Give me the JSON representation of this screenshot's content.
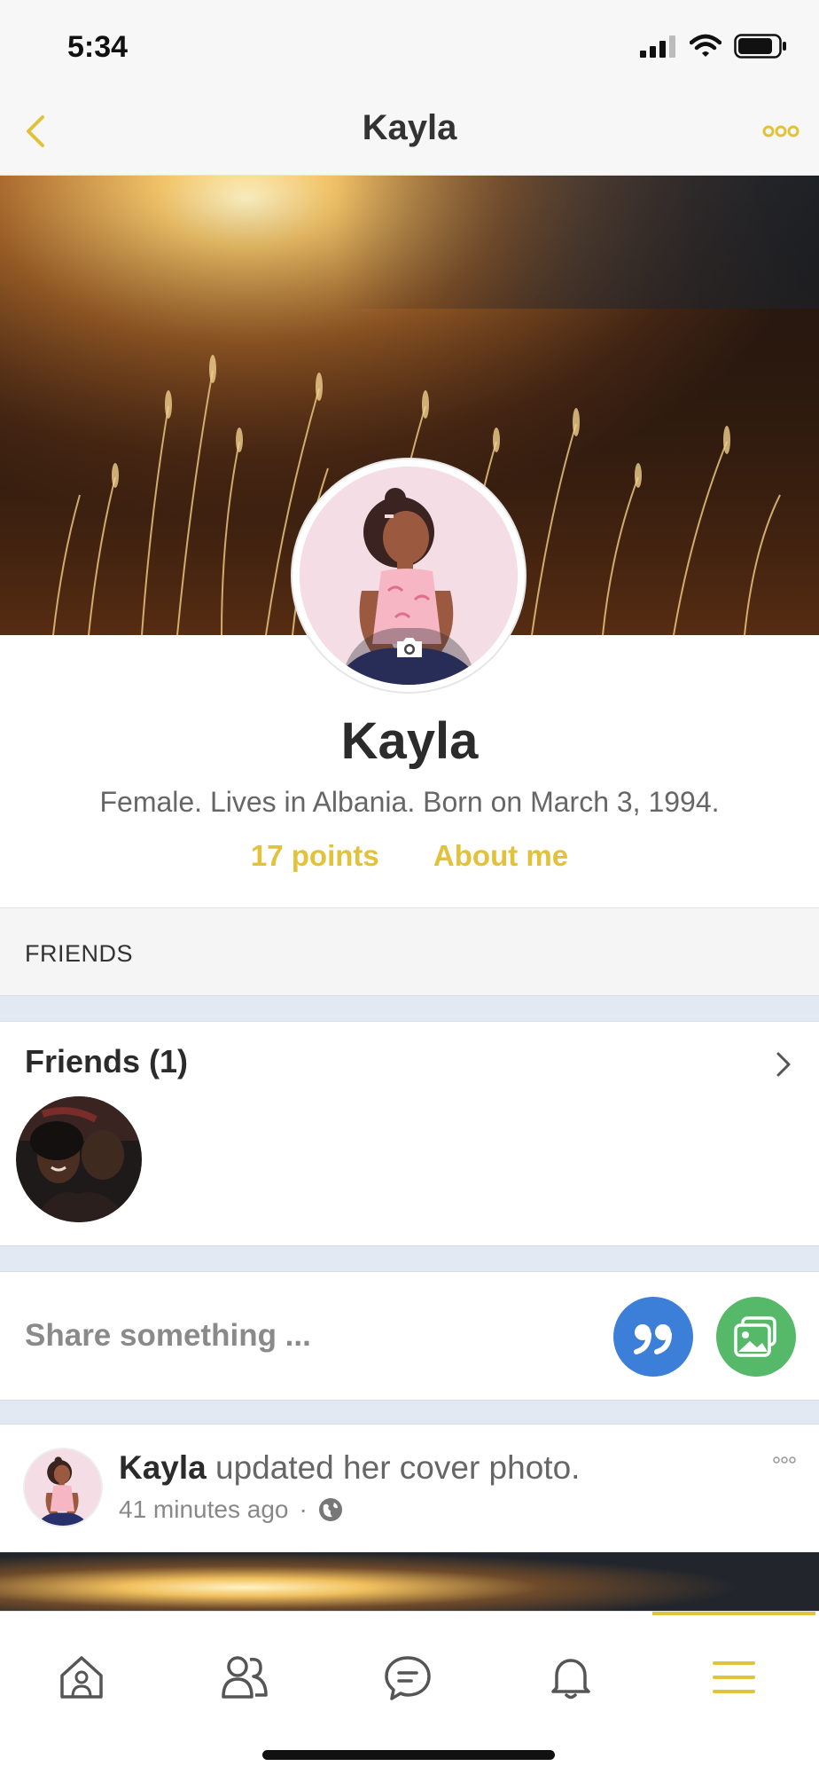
{
  "status_bar": {
    "time": "5:34"
  },
  "nav": {
    "title": "Kayla"
  },
  "profile": {
    "name": "Kayla",
    "bio": "Female. Lives in Albania. Born on March 3, 1994.",
    "points_link": "17 points",
    "about_link": "About me"
  },
  "friends_section": {
    "header": "FRIENDS",
    "title": "Friends (1)"
  },
  "share": {
    "placeholder": "Share something ..."
  },
  "post": {
    "author": "Kayla",
    "action": " updated her cover photo.",
    "time": "41 minutes ago",
    "separator": "·"
  },
  "colors": {
    "accent": "#e2c23b",
    "quote_btn": "#3c7fd9",
    "image_btn": "#56b96a"
  },
  "tabs": [
    {
      "name": "home",
      "icon": "home-icon"
    },
    {
      "name": "friends",
      "icon": "people-icon"
    },
    {
      "name": "messages",
      "icon": "chat-icon"
    },
    {
      "name": "notifications",
      "icon": "bell-icon"
    },
    {
      "name": "menu",
      "icon": "hamburger-menu-icon",
      "active": true
    }
  ]
}
